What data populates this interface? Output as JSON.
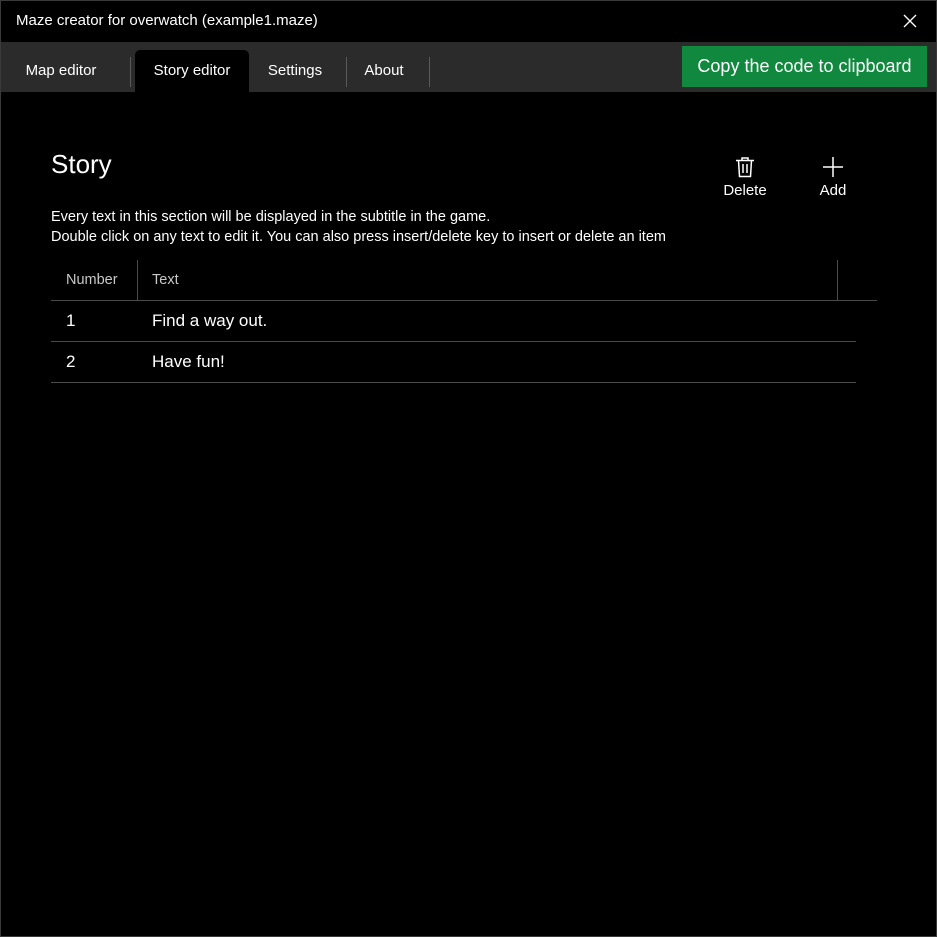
{
  "window": {
    "title": "Maze creator for overwatch (example1.maze)",
    "close_icon": "close-icon"
  },
  "tabs": [
    {
      "label": "Map editor",
      "active": false
    },
    {
      "label": "Story editor",
      "active": true
    },
    {
      "label": "Settings",
      "active": false
    },
    {
      "label": "About",
      "active": false
    }
  ],
  "toolbar": {
    "copy_label": "Copy the code to clipboard",
    "copy_color": "#10893e"
  },
  "story": {
    "title": "Story",
    "description_line1": "Every text in this section will be displayed in the subtitle in the game.",
    "description_line2": "Double click on any text to edit it. You can also press insert/delete key to insert or delete an item",
    "delete_label": "Delete",
    "delete_icon": "trash-icon",
    "add_label": "Add",
    "add_icon": "plus-icon"
  },
  "table": {
    "columns": [
      "Number",
      "Text"
    ],
    "rows": [
      {
        "number": "1",
        "text": "Find a way out."
      },
      {
        "number": "2",
        "text": "Have fun!"
      }
    ]
  }
}
